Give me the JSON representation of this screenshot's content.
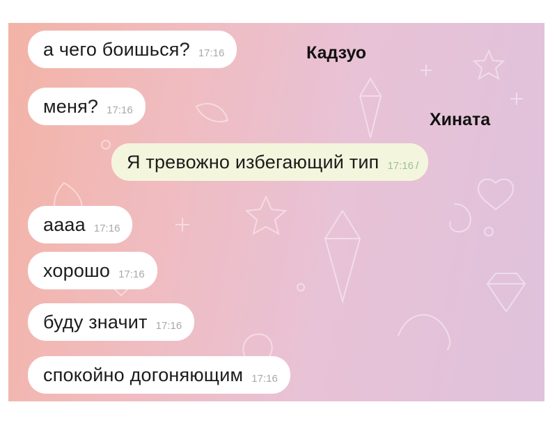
{
  "participants": {
    "left_name": "Кадзуо",
    "right_name": "Хината"
  },
  "messages": [
    {
      "text": "а чего боишься?",
      "time": "17:16",
      "direction": "in"
    },
    {
      "text": "меня?",
      "time": "17:16",
      "direction": "in"
    },
    {
      "text": "Я тревожно избегающий тип",
      "time": "17:16",
      "direction": "out",
      "read_checks": "//"
    },
    {
      "text": "аааа",
      "time": "17:16",
      "direction": "in"
    },
    {
      "text": "хорошо",
      "time": "17:16",
      "direction": "in"
    },
    {
      "text": "буду значит",
      "time": "17:16",
      "direction": "in"
    },
    {
      "text": "спокойно догоняющим",
      "time": "17:16",
      "direction": "in"
    }
  ],
  "colors": {
    "incoming_bubble": "#ffffff",
    "outgoing_bubble": "#f4f5dd",
    "time": "#a9a9a9"
  }
}
